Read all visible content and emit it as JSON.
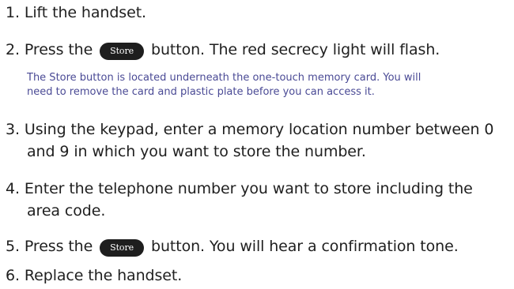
{
  "steps": {
    "s1": {
      "num": "1.",
      "text": "Lift the handset."
    },
    "s2": {
      "num": "2.",
      "pre": "Press the",
      "button": "Store",
      "post": "button. The red secrecy light will flash."
    },
    "note": {
      "line1": "The Store button is located underneath the one-touch memory card. You will",
      "line2": "need to remove the card and plastic plate before you can access it."
    },
    "s3": {
      "num": "3.",
      "line1": "Using the keypad, enter a memory location number between 0",
      "line2": "and 9 in which you want to store the number."
    },
    "s4": {
      "num": "4.",
      "line1": "Enter the telephone number you want to store including the",
      "line2": "area code."
    },
    "s5": {
      "num": "5.",
      "pre": "Press the",
      "button": "Store",
      "post": "button. You will hear a confirmation tone."
    },
    "s6": {
      "num": "6.",
      "text": "Replace the handset."
    }
  }
}
